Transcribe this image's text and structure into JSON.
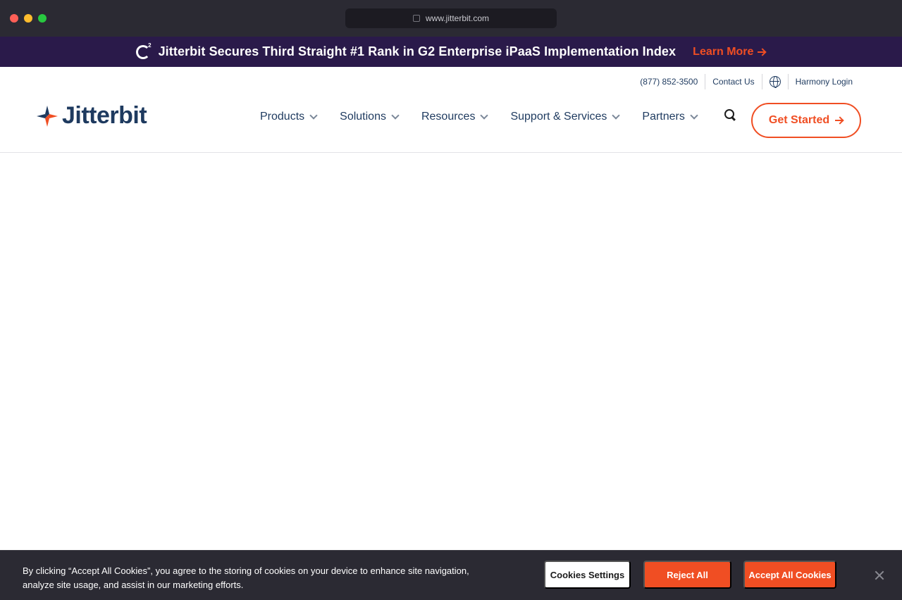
{
  "browser": {
    "url": "www.jitterbit.com"
  },
  "announcement": {
    "headline": "Jitterbit Secures Third Straight #1 Rank in G2 Enterprise iPaaS Implementation Index",
    "link_label": "Learn More"
  },
  "utility_nav": {
    "phone": "(877) 852-3500",
    "contact": "Contact Us",
    "login": "Harmony Login"
  },
  "logo": {
    "wordmark": "Jitterbit"
  },
  "nav": {
    "items": [
      {
        "label": "Products"
      },
      {
        "label": "Solutions"
      },
      {
        "label": "Resources"
      },
      {
        "label": "Support & Services"
      },
      {
        "label": "Partners"
      }
    ],
    "cta_label": "Get Started"
  },
  "cookie_banner": {
    "text": "By clicking “Accept All Cookies”, you agree to the storing of cookies on your device to enhance site navigation, analyze site usage, and assist in our marketing efforts.",
    "settings_label": "Cookies Settings",
    "reject_label": "Reject All",
    "accept_label": "Accept All Cookies"
  },
  "colors": {
    "brand_navy": "#1e3a5f",
    "brand_orange": "#f04e23",
    "announce_bg": "#2a1a4a",
    "chrome_bg": "#2b2a33"
  }
}
